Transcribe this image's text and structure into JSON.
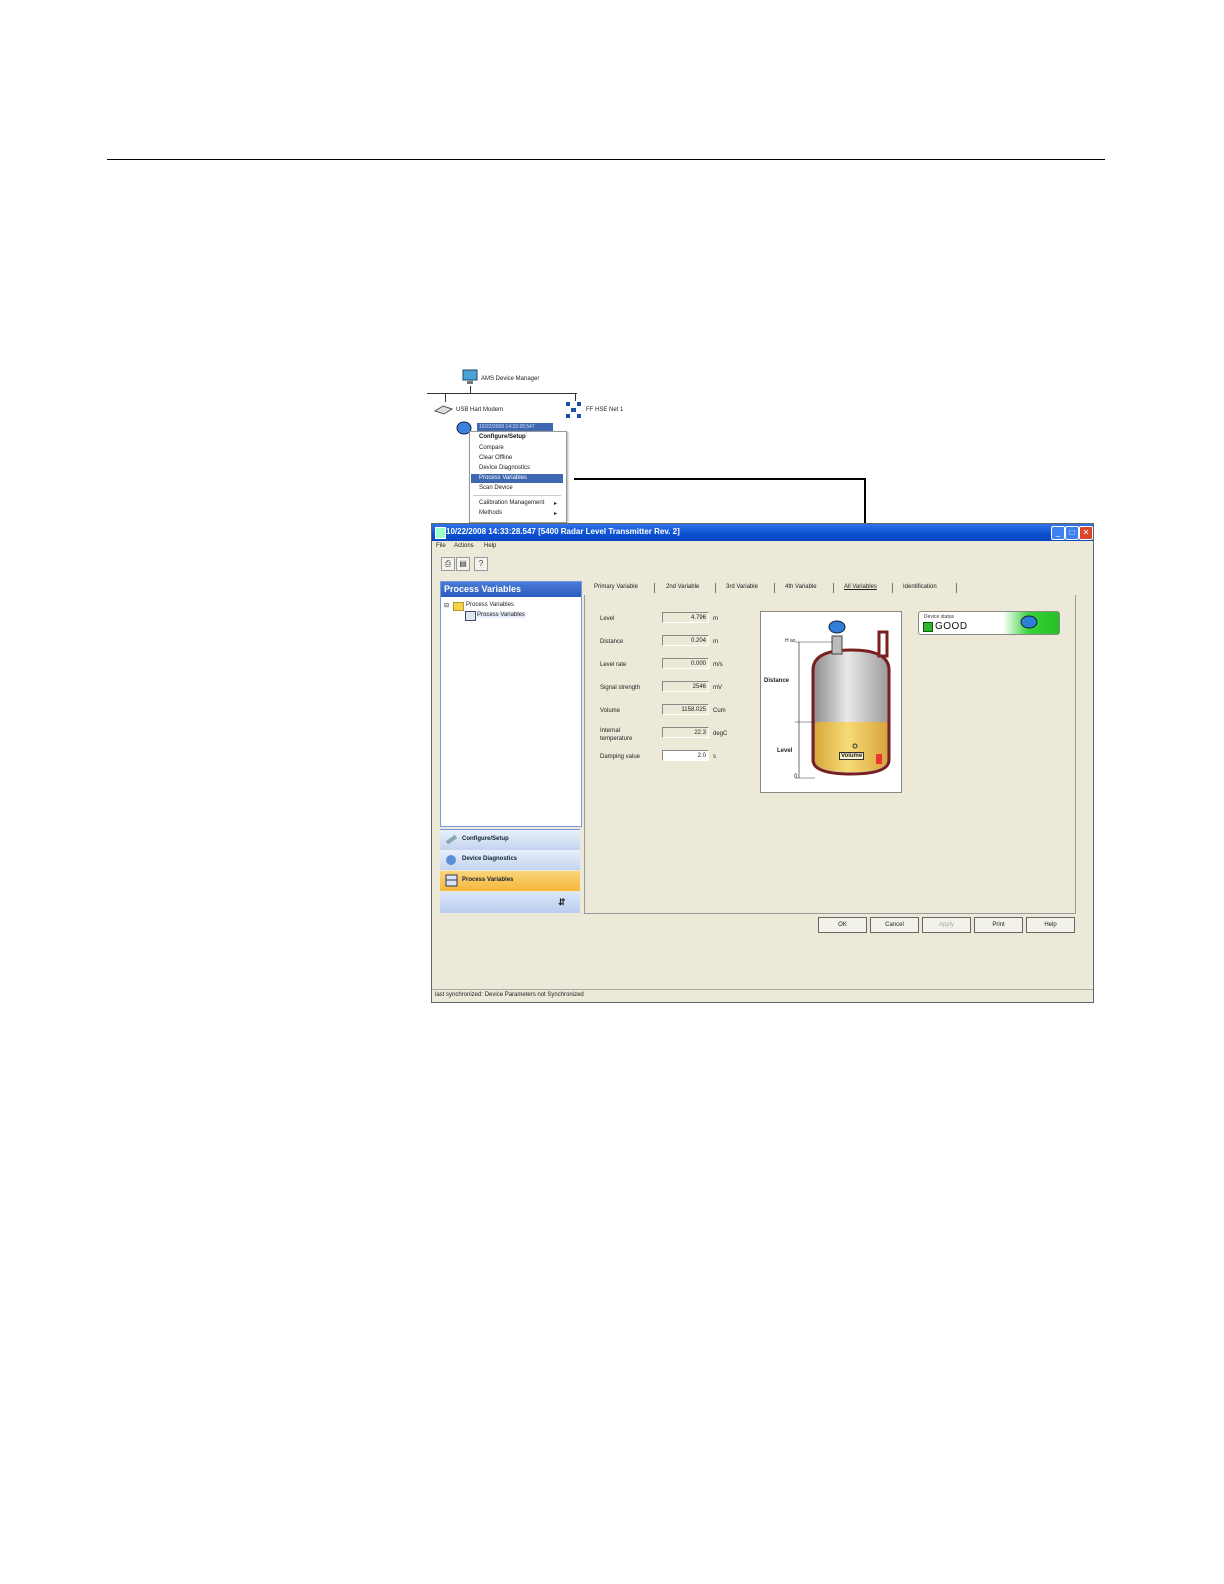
{
  "tree": {
    "manager_label": "AMS Device Manager",
    "modem_label": "USB Hart Modem",
    "network_label": "FF HSE Net 1",
    "device_label": "10/22/2008 14:33:28.547"
  },
  "context_menu": {
    "items": [
      "Configure/Setup",
      "Compare",
      "Clear Offline",
      "Device Diagnostics",
      "Process Variables",
      "Scan Device",
      "Calibration Management",
      "Methods"
    ],
    "selected": "Process Variables"
  },
  "window": {
    "title": "10/22/2008 14:33:28.547 [5400 Radar Level Transmitter Rev. 2]",
    "menu": [
      "File",
      "Actions",
      "Help"
    ],
    "left_header": "Process Variables",
    "tree_root": "Process Variables",
    "tree_child": "Process Variables",
    "nav": [
      "Configure/Setup",
      "Device Diagnostics",
      "Process Variables"
    ],
    "tabs": [
      "Primary Variable",
      "2nd Variable",
      "3rd Variable",
      "4th Variable",
      "All Variables",
      "Identification"
    ],
    "active_tab": "All Variables",
    "variables": [
      {
        "label": "Level",
        "value": "4.796",
        "unit": "m"
      },
      {
        "label": "Distance",
        "value": "0.204",
        "unit": "m"
      },
      {
        "label": "Level rate",
        "value": "0.000",
        "unit": "m/s"
      },
      {
        "label": "Signal strength",
        "value": "2546",
        "unit": "mV"
      },
      {
        "label": "Volume",
        "value": "1158.025",
        "unit": "Cum"
      },
      {
        "label": "Internal temperature",
        "value": "22.3",
        "unit": "degC"
      },
      {
        "label": "Damping value",
        "value": "2.0",
        "unit": "s"
      }
    ],
    "tank": {
      "hmax": "H ax",
      "distance": "Distance",
      "level": "Level",
      "zero": "0",
      "volume": "Volume"
    },
    "device_status_label": "Device status",
    "device_status_value": "GOOD",
    "buttons": [
      "OK",
      "Cancel",
      "Apply",
      "Print",
      "Help"
    ],
    "status_bar": "last synchronized: Device Parameters not Synchronized"
  },
  "colors": {
    "title_blue": "#0b4fd1",
    "status_green": "#24c124",
    "nav_active": "#f6b73c",
    "liquid": "#f5cf55"
  }
}
